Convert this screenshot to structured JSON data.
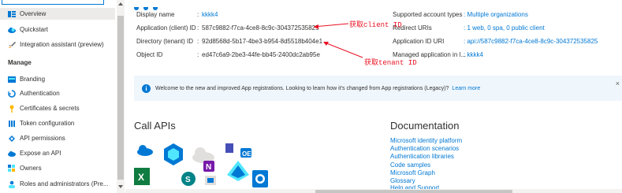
{
  "nav": {
    "items": [
      {
        "label": "Overview",
        "icon": "overview-icon"
      },
      {
        "label": "Quickstart",
        "icon": "cloud-icon"
      },
      {
        "label": "Integration assistant (preview)",
        "icon": "rocket-icon"
      },
      {
        "label": "Branding",
        "icon": "branding-icon"
      },
      {
        "label": "Authentication",
        "icon": "authentication-icon"
      },
      {
        "label": "Certificates & secrets",
        "icon": "key-icon"
      },
      {
        "label": "Token configuration",
        "icon": "token-icon"
      },
      {
        "label": "API permissions",
        "icon": "api-permissions-icon"
      },
      {
        "label": "Expose an API",
        "icon": "cloud-icon"
      },
      {
        "label": "Owners",
        "icon": "owners-icon"
      },
      {
        "label": "Roles and administrators (Pre...",
        "icon": "roles-icon"
      }
    ],
    "section_manage": "Manage"
  },
  "essentials": {
    "left": [
      {
        "label": "Display name",
        "value": "kkkk4",
        "link": true
      },
      {
        "label": "Application (client) ID",
        "value": "587c9882-f7ca-4ce8-8c9c-304372535825",
        "link": false
      },
      {
        "label": "Directory (tenant) ID",
        "value": "92d8568d-5b17-4be3-b954-8d5518b404e1",
        "link": false
      },
      {
        "label": "Object ID",
        "value": "ed47c6a9-2be3-44fe-bb45-2400dc2ab95e",
        "link": false
      }
    ],
    "right": [
      {
        "label": "Supported account types",
        "value": "Multiple organizations"
      },
      {
        "label": "Redirect URIs",
        "value": "1 web, 0 spa, 0 public client"
      },
      {
        "label": "Application ID URI",
        "value": "api://587c9882-f7ca-4ce8-8c9c-304372535825"
      },
      {
        "label": "Managed application in l...",
        "value": "kkkk4"
      }
    ]
  },
  "annotations": {
    "client": "获取client ID",
    "tenant": "获取tenant ID"
  },
  "banner": {
    "text": "Welcome to the new and improved App registrations. Looking to learn how it's changed from App registrations (Legacy)?",
    "link": "Learn more",
    "close": "×"
  },
  "call_apis": {
    "title": "Call APIs"
  },
  "documentation": {
    "title": "Documentation",
    "links": [
      "Microsoft identity platform",
      "Authentication scenarios",
      "Authentication libraries",
      "Code samples",
      "Microsoft Graph",
      "Glossary",
      "Help and Support"
    ]
  },
  "colors": {
    "accent": "#0078d4",
    "annotation": "#e81123",
    "banner_bg": "#eff6fc"
  }
}
